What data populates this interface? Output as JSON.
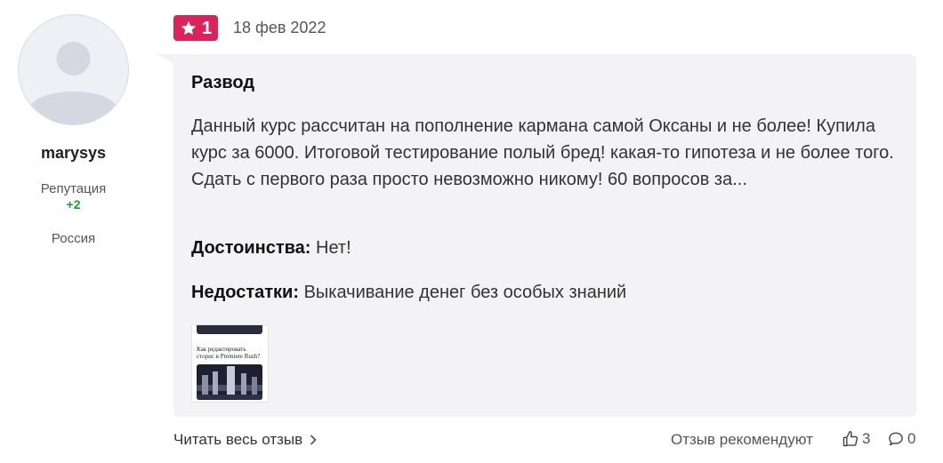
{
  "user": {
    "name": "marysys",
    "reputation_label": "Репутация",
    "reputation_value": "+2",
    "country": "Россия"
  },
  "review": {
    "rating": "1",
    "date": "18 фев 2022",
    "title": "Развод",
    "text": "Данный курс рассчитан на пополнение кармана самой Оксаны и не более! Купила курс за 6000. Итоговой тестирование полый бред! какая-то гипотеза и не более того. Сдать с первого раза просто невозможно никому! 60 вопросов за...",
    "pros_label": "Достоинства:",
    "pros_value": "Нет!",
    "cons_label": "Недостатки:",
    "cons_value": "Выкачивание денег без особых знаний",
    "thumbnail_caption": "Как редактировать сторис в Premiere Rush?"
  },
  "footer": {
    "read_full_label": "Читать весь отзыв",
    "recommend_label": "Отзыв рекомендуют",
    "likes_count": "3",
    "comments_count": "0"
  },
  "colors": {
    "rating_badge": "#d9235a",
    "reputation_positive": "#1a9c2a",
    "card_background": "#f3f3f5"
  },
  "icons": {
    "rating": "star-icon",
    "read_more": "chevron-right-icon",
    "likes": "thumbs-up-icon",
    "comments": "comment-icon"
  }
}
